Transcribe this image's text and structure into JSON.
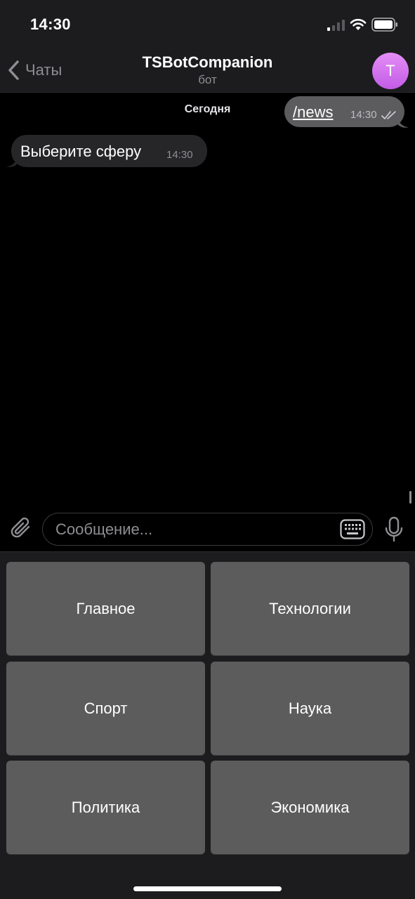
{
  "status_bar": {
    "time": "14:30",
    "icons": [
      "cellular-signal-icon",
      "wifi-icon",
      "battery-icon"
    ]
  },
  "header": {
    "back_label": "Чаты",
    "title": "TSBotCompanion",
    "subtitle": "бот",
    "avatar_letter": "T",
    "avatar_color": "#d97af0"
  },
  "chat": {
    "date_label": "Сегодня",
    "messages": [
      {
        "direction": "outgoing",
        "text": "/news",
        "time": "14:30",
        "status": "read"
      },
      {
        "direction": "incoming",
        "text": "Выберите сферу",
        "time": "14:30"
      }
    ]
  },
  "composer": {
    "placeholder": "Сообщение...",
    "value": ""
  },
  "bot_keyboard": {
    "buttons": [
      {
        "label": "Главное"
      },
      {
        "label": "Технологии"
      },
      {
        "label": "Спорт"
      },
      {
        "label": "Наука"
      },
      {
        "label": "Политика"
      },
      {
        "label": "Экономика"
      }
    ]
  },
  "colors": {
    "background": "#000000",
    "bar_background": "#1c1c1e",
    "outgoing_bubble": "#5c5c5e",
    "incoming_bubble": "#262628",
    "keyboard_button": "#5c5c5c",
    "secondary_text": "#8e8e93"
  }
}
